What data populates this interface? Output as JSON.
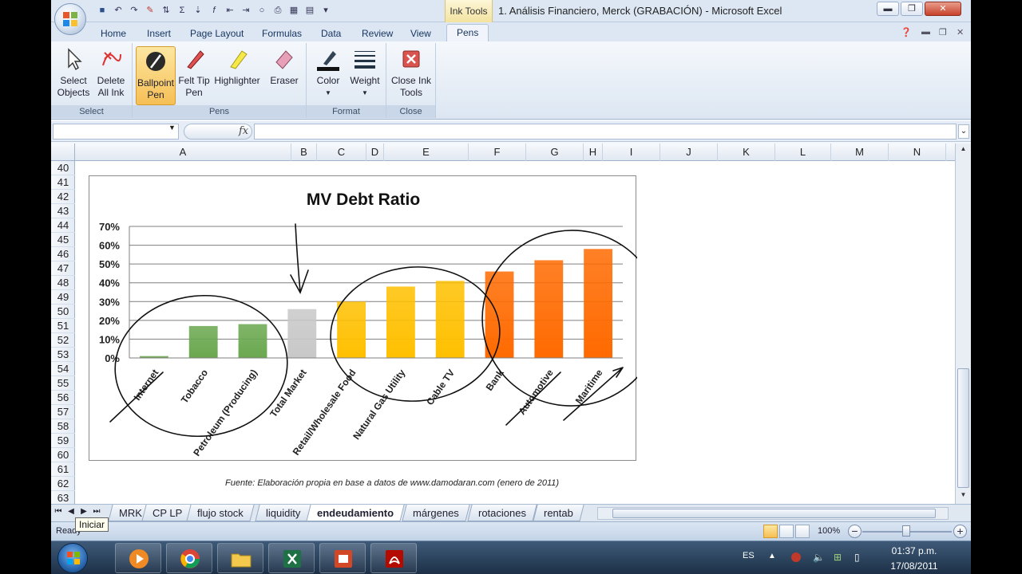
{
  "window": {
    "title": "1. Análisis Financiero, Merck (GRABACIÓN)  -  Microsoft Excel",
    "context_tab": "Ink Tools",
    "controls": {
      "minimize": "▬",
      "maximize": "❐",
      "close": "✕"
    }
  },
  "ribbon_tabs": [
    "Home",
    "Insert",
    "Page Layout",
    "Formulas",
    "Data",
    "Review",
    "View",
    "Pens"
  ],
  "ribbon": {
    "select_group": {
      "label": "Select",
      "select_objects": "Select Objects",
      "delete_all_ink": "Delete All Ink"
    },
    "pens_group": {
      "label": "Pens",
      "ballpoint": "Ballpoint Pen",
      "felt_tip": "Felt Tip Pen",
      "highlighter": "Highlighter",
      "eraser": "Eraser"
    },
    "format_group": {
      "label": "Format",
      "color": "Color",
      "weight": "Weight"
    },
    "close_group": {
      "label": "Close",
      "close_ink": "Close Ink Tools"
    }
  },
  "formula_bar": {
    "fx": "fx",
    "expand": "⌄"
  },
  "columns": [
    "A",
    "B",
    "C",
    "D",
    "E",
    "F",
    "G",
    "H",
    "I",
    "J",
    "K",
    "L",
    "M",
    "N"
  ],
  "rows": [
    "40",
    "41",
    "42",
    "43",
    "44",
    "45",
    "46",
    "47",
    "48",
    "49",
    "50",
    "51",
    "52",
    "53",
    "54",
    "55",
    "56",
    "57",
    "58",
    "59",
    "60",
    "61",
    "62",
    "63"
  ],
  "chart_data": {
    "type": "bar",
    "title": "MV Debt Ratio",
    "categories": [
      "Internet",
      "Tobacco",
      "Petroleum (Producing)",
      "Total Market",
      "Retail/Wholesale Food",
      "Natural Gas Utility",
      "Cable TV",
      "Bank",
      "Automotive",
      "Maritime"
    ],
    "values": [
      0.01,
      0.17,
      0.18,
      0.26,
      0.3,
      0.38,
      0.41,
      0.46,
      0.52,
      0.58
    ],
    "colors": [
      "#6aa84f",
      "#6aa84f",
      "#6aa84f",
      "#c8c8c8",
      "#ffc000",
      "#ffc000",
      "#ffc000",
      "#ff6a00",
      "#ff6a00",
      "#ff6a00"
    ],
    "ylim": [
      0,
      0.7
    ],
    "yticks": [
      "0%",
      "10%",
      "20%",
      "30%",
      "40%",
      "50%",
      "60%",
      "70%"
    ],
    "grid": true,
    "xlabel": "",
    "ylabel": ""
  },
  "source_note": "Fuente: Elaboración propia en base a datos de www.damodaran.com (enero de 2011)",
  "sheet_tabs": [
    "MRK",
    "CP LP",
    "flujo stock",
    "liquidity",
    "endeudamiento",
    "márgenes",
    "rotaciones",
    "rentab"
  ],
  "active_sheet": "endeudamiento",
  "status": {
    "text": "Ready",
    "tooltip": "Iniciar",
    "zoom": "100%"
  },
  "taskbar": {
    "language": "ES",
    "time": "01:37 p.m.",
    "date": "17/08/2011"
  }
}
